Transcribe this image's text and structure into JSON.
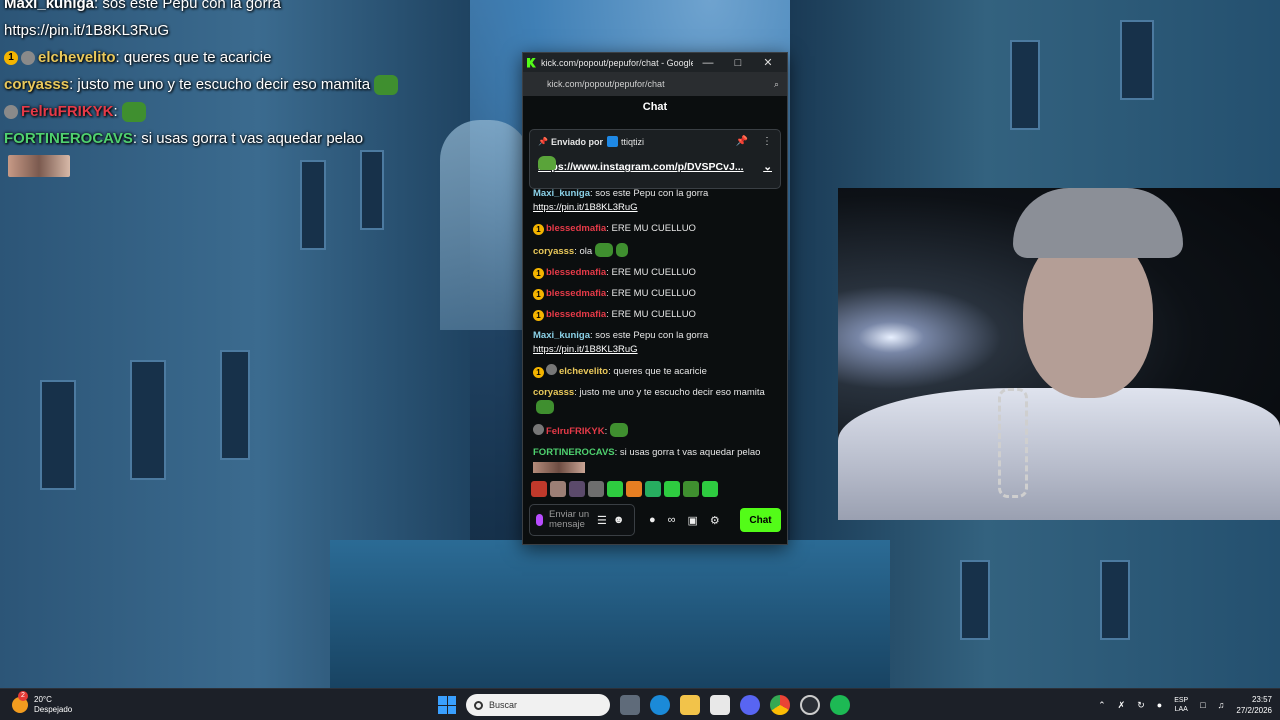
{
  "overlay": {
    "lines": [
      {
        "user": "Maxi_kuniga",
        "text": ": sos este Pepu con la gorra"
      },
      {
        "user": "",
        "text": "https://pin.it/1B8KL3RuG"
      },
      {
        "user": "elchevelito",
        "text": ": queres que te acaricie"
      },
      {
        "user": "coryasss",
        "text": ": justo me uno y te escucho decir eso mamita"
      },
      {
        "user": "FelruFRIKYK",
        "text": ":"
      },
      {
        "user": "FORTINEROCAVS",
        "text": ": si usas gorra t vas aquedar pelao"
      }
    ],
    "badge_number": "1"
  },
  "window": {
    "title": "kick.com/popout/pepufor/chat - Google C...",
    "url": "kick.com/popout/pepufor/chat",
    "minimize": "—",
    "maximize": "□",
    "close": "✕",
    "zoom_icon": "⌕"
  },
  "chat": {
    "header": "Chat",
    "pinned": {
      "label": "Enviado por",
      "user": "ttiqtizi",
      "link": "https://www.instagram.com/p/DVSPCvJ...",
      "pin_icon": "📌",
      "more_icon": "⋮",
      "expand_icon": "⌄"
    },
    "messages": [
      {
        "user": "Maxi_kuniga",
        "text": ": sos este Pepu con la gorra",
        "link": "https://pin.it/1B8KL3RuG"
      },
      {
        "user": "blessedmafia",
        "text": ": ERE MU CUELLUO"
      },
      {
        "user": "coryasss",
        "text": ": ola"
      },
      {
        "user": "blessedmafia",
        "text": ": ERE MU CUELLUO"
      },
      {
        "user": "blessedmafia",
        "text": ": ERE MU CUELLUO"
      },
      {
        "user": "blessedmafia",
        "text": ": ERE MU CUELLUO"
      },
      {
        "user": "Maxi_kuniga",
        "text": ": sos este Pepu con la gorra",
        "link": "https://pin.it/1B8KL3RuG"
      },
      {
        "user": "elchevelito",
        "text": ": queres que te acaricie"
      },
      {
        "user": "coryasss",
        "text": ": justo me uno y te escucho decir eso mamita"
      },
      {
        "user": "FelruFRIKYK",
        "text": ":"
      },
      {
        "user": "FORTINEROCAVS",
        "text": ": si usas gorra t vas aquedar pelao"
      }
    ],
    "badge_number": "1",
    "input_placeholder": "Enviar un mensaje",
    "send_label": "Chat",
    "icons": {
      "gif": "☰",
      "emoji": "☻",
      "dots": "●",
      "infinity": "∞",
      "store": "▣",
      "settings": "⚙"
    }
  },
  "taskbar": {
    "temperature": "20°C",
    "weather": "Despejado",
    "weather_badge": "2",
    "search_placeholder": "Buscar",
    "lang_top": "ESP",
    "lang_bottom": "LAA",
    "time": "23:57",
    "date": "27/2/2026"
  },
  "colors": {
    "kick_green": "#53fc18",
    "username_red": "#e53a48",
    "username_green": "#4fd16f",
    "username_blue": "#8bd2e8"
  }
}
